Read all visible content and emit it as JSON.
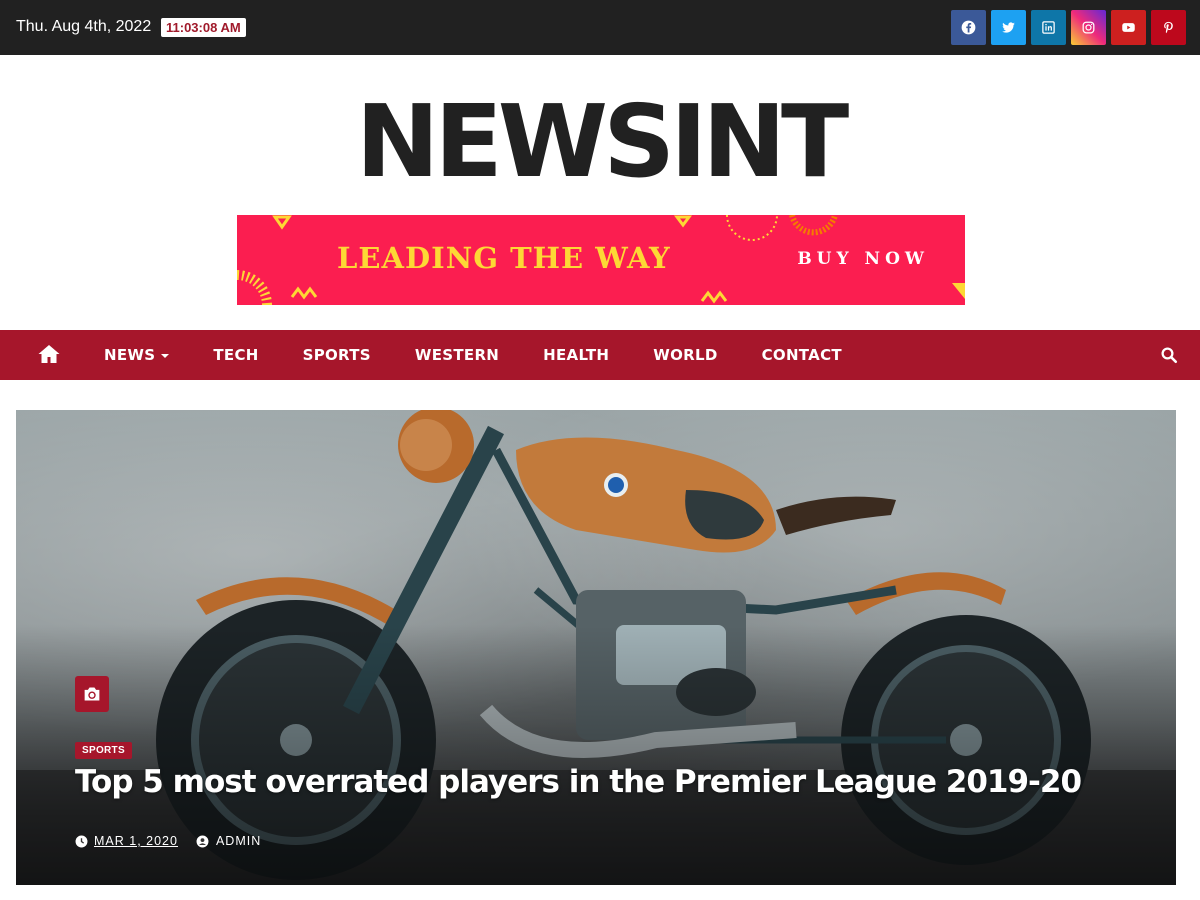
{
  "topbar": {
    "date": "Thu. Aug 4th, 2022",
    "time": "11:03:08 AM",
    "socials": [
      {
        "icon": "facebook-icon",
        "color": "#3b5998"
      },
      {
        "icon": "twitter-icon",
        "color": "#1da1f2"
      },
      {
        "icon": "linkedin-icon",
        "color": "#0e76a8"
      },
      {
        "icon": "instagram-icon",
        "color": "#c13584"
      },
      {
        "icon": "youtube-icon",
        "color": "#cd201f"
      },
      {
        "icon": "pinterest-icon",
        "color": "#bd081c"
      }
    ]
  },
  "logo": "NEWSINT",
  "banner": {
    "headline": "LEADING THE WAY",
    "cta": "BUY NOW",
    "bg_color": "#fb1e50",
    "text_color": "#fdd835"
  },
  "nav": {
    "color": "#a6162b",
    "items": [
      {
        "label": "NEWS",
        "dropdown": true
      },
      {
        "label": "TECH"
      },
      {
        "label": "SPORTS"
      },
      {
        "label": "WESTERN"
      },
      {
        "label": "HEALTH"
      },
      {
        "label": "WORLD"
      },
      {
        "label": "CONTACT"
      }
    ]
  },
  "hero": {
    "category": "SPORTS",
    "title": "Top 5 most overrated players in the Premier League 2019-20",
    "date": "MAR 1, 2020",
    "author": "ADMIN"
  }
}
